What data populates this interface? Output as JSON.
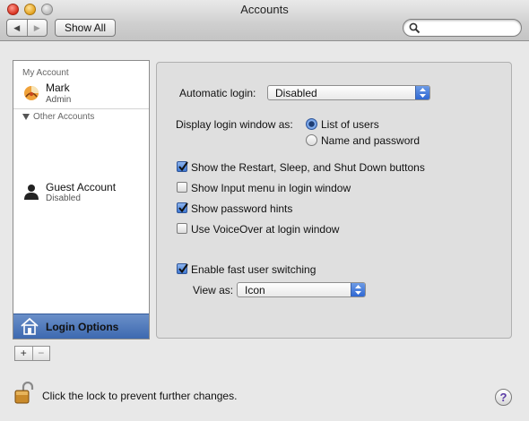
{
  "window": {
    "title": "Accounts",
    "show_all_label": "Show All",
    "back_icon": "back-arrow-icon",
    "forward_icon": "forward-arrow-icon",
    "search_placeholder": ""
  },
  "sidebar": {
    "my_account_heading": "My Account",
    "my_account": {
      "name": "Mark",
      "role": "Admin",
      "icon": "user-picture-icon"
    },
    "other_accounts_heading": "Other Accounts",
    "guest": {
      "name": "Guest Account",
      "status": "Disabled",
      "icon": "guest-silhouette-icon"
    },
    "login_options_label": "Login Options",
    "selected": "Login Options",
    "add_label": "+",
    "remove_label": "−"
  },
  "login_options": {
    "automatic_login_label": "Automatic login:",
    "automatic_login_value": "Disabled",
    "display_login_window_label": "Display login window as:",
    "display_options": [
      {
        "label": "List of users",
        "selected": true
      },
      {
        "label": "Name and password",
        "selected": false
      }
    ],
    "checkboxes": [
      {
        "label": "Show the Restart, Sleep, and Shut Down buttons",
        "checked": true
      },
      {
        "label": "Show Input menu in login window",
        "checked": false
      },
      {
        "label": "Show password hints",
        "checked": true
      },
      {
        "label": "Use VoiceOver at login window",
        "checked": false
      }
    ],
    "fast_user_switching": {
      "label": "Enable fast user switching",
      "checked": true
    },
    "view_as_label": "View as:",
    "view_as_value": "Icon"
  },
  "footer": {
    "lock_text": "Click the lock to prevent further changes.",
    "lock_icon": "unlocked-padlock-icon",
    "help_label": "?"
  },
  "colors": {
    "selection": "#3d69b0",
    "control_accent": "#3f78d2",
    "help_glyph": "#5a3aa5"
  }
}
